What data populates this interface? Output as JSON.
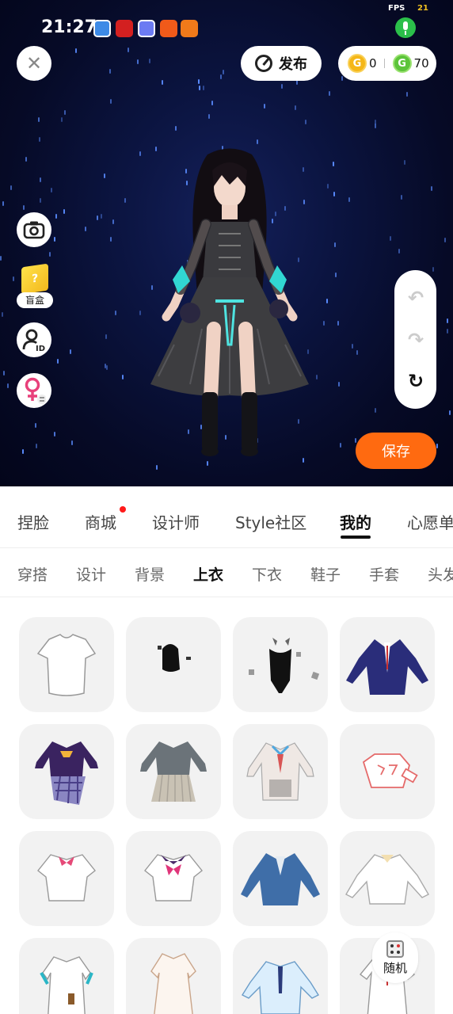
{
  "status_bar": {
    "time": "21:27",
    "fps_label": "FPS",
    "fps_value": "21"
  },
  "header": {
    "publish_label": "发布",
    "coins": {
      "gold": "0",
      "green": "70"
    }
  },
  "side": {
    "blind_box_label": "盲盒"
  },
  "actions": {
    "save_label": "保存",
    "random_label": "随机"
  },
  "main_tabs": [
    {
      "label": "捏脸"
    },
    {
      "label": "商城"
    },
    {
      "label": "设计师"
    },
    {
      "label": "Style社区"
    },
    {
      "label": "我的"
    },
    {
      "label": "心愿单"
    }
  ],
  "sub_tabs": [
    {
      "label": "穿搭"
    },
    {
      "label": "设计"
    },
    {
      "label": "背景"
    },
    {
      "label": "上衣"
    },
    {
      "label": "下衣"
    },
    {
      "label": "鞋子"
    },
    {
      "label": "手套"
    },
    {
      "label": "头发"
    }
  ],
  "colors": {
    "accent": "#ff6a10",
    "scene_bg": "#0b1440",
    "active_tab": "#111111"
  }
}
